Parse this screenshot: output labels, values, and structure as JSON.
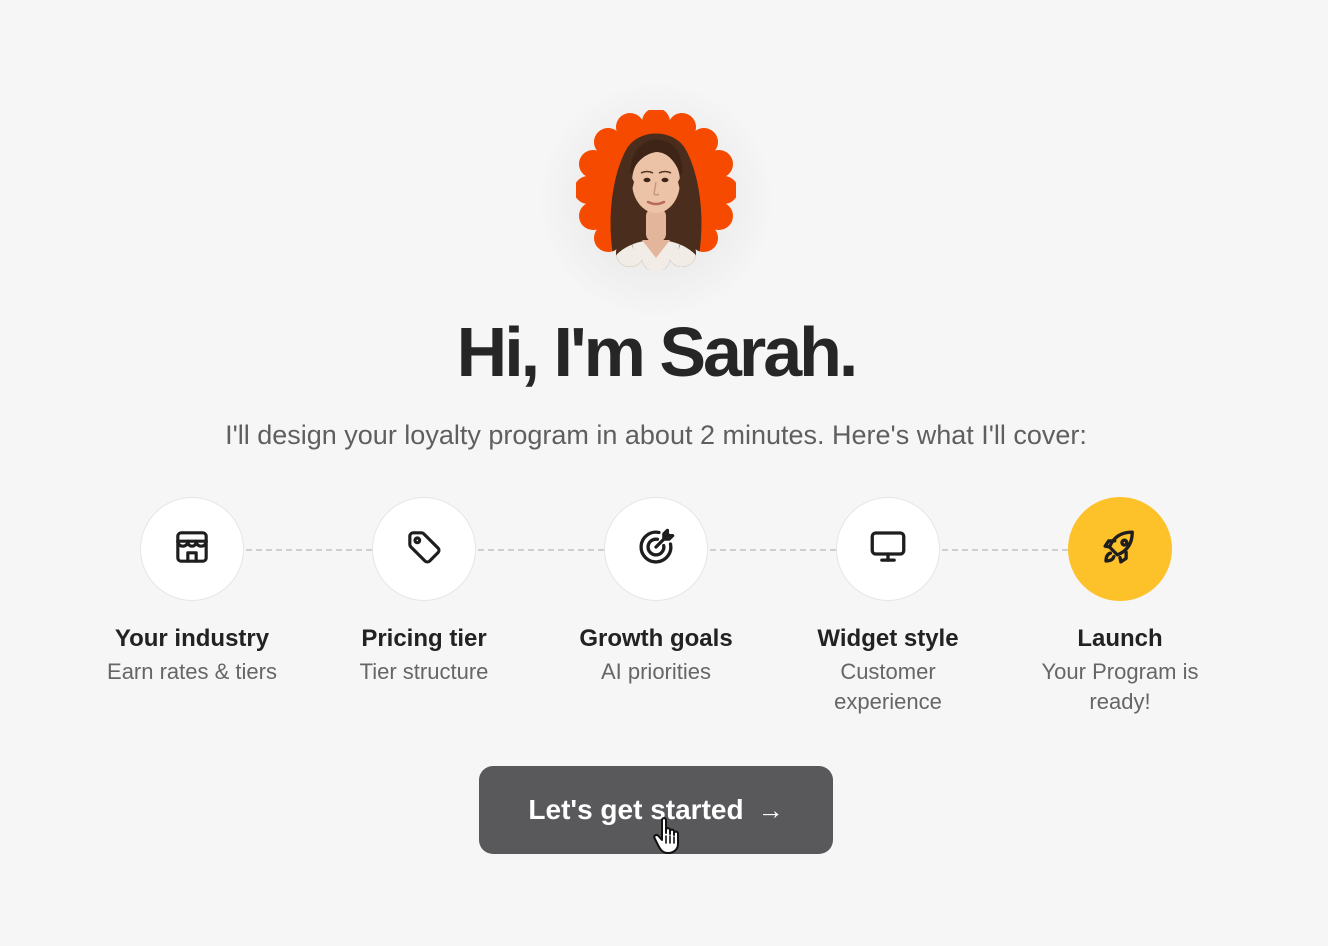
{
  "hero": {
    "title": "Hi, I'm Sarah.",
    "subtitle": "I'll design your loyalty program in about 2 minutes. Here's what I'll cover:",
    "avatar_bg_color": "#f54a00"
  },
  "steps": [
    {
      "title": "Your industry",
      "subtitle": "Earn rates & tiers",
      "icon": "storefront-icon",
      "active": false
    },
    {
      "title": "Pricing tier",
      "subtitle": "Tier structure",
      "icon": "tag-icon",
      "active": false
    },
    {
      "title": "Growth goals",
      "subtitle": "AI priorities",
      "icon": "target-icon",
      "active": false
    },
    {
      "title": "Widget style",
      "subtitle": "Customer experience",
      "icon": "monitor-icon",
      "active": false
    },
    {
      "title": "Launch",
      "subtitle": "Your Program is ready!",
      "icon": "rocket-icon",
      "active": true
    }
  ],
  "cta": {
    "label": "Let's get started",
    "arrow": "→"
  },
  "colors": {
    "accent": "#fdc12a",
    "button": "#59595c",
    "background": "#f6f6f6"
  }
}
